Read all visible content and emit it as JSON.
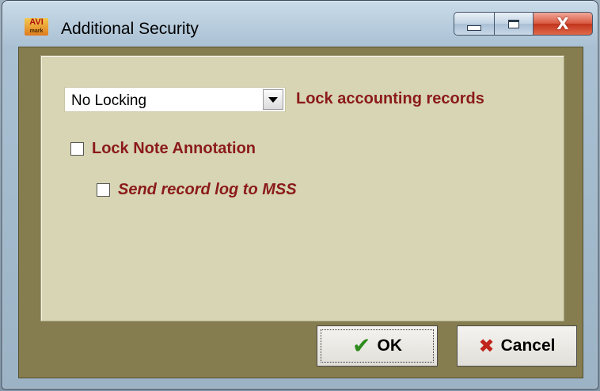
{
  "window": {
    "title": "Additional Security",
    "icon_text_top": "AVI",
    "icon_text_bottom": "mark",
    "close_glyph": "X"
  },
  "form": {
    "lock_select": {
      "value": "No Locking"
    },
    "lock_accounting_label": "Lock accounting records",
    "lock_note": {
      "label": "Lock Note Annotation",
      "checked": false
    },
    "send_log": {
      "label": "Send record log to MSS",
      "checked": false
    }
  },
  "buttons": {
    "ok": {
      "label": "OK",
      "icon": "checkmark-icon"
    },
    "cancel": {
      "label": "Cancel",
      "icon": "x-icon"
    }
  },
  "colors": {
    "label_red": "#8b1a1a",
    "panel": "#d7d5b3",
    "frame": "#857c4f"
  }
}
